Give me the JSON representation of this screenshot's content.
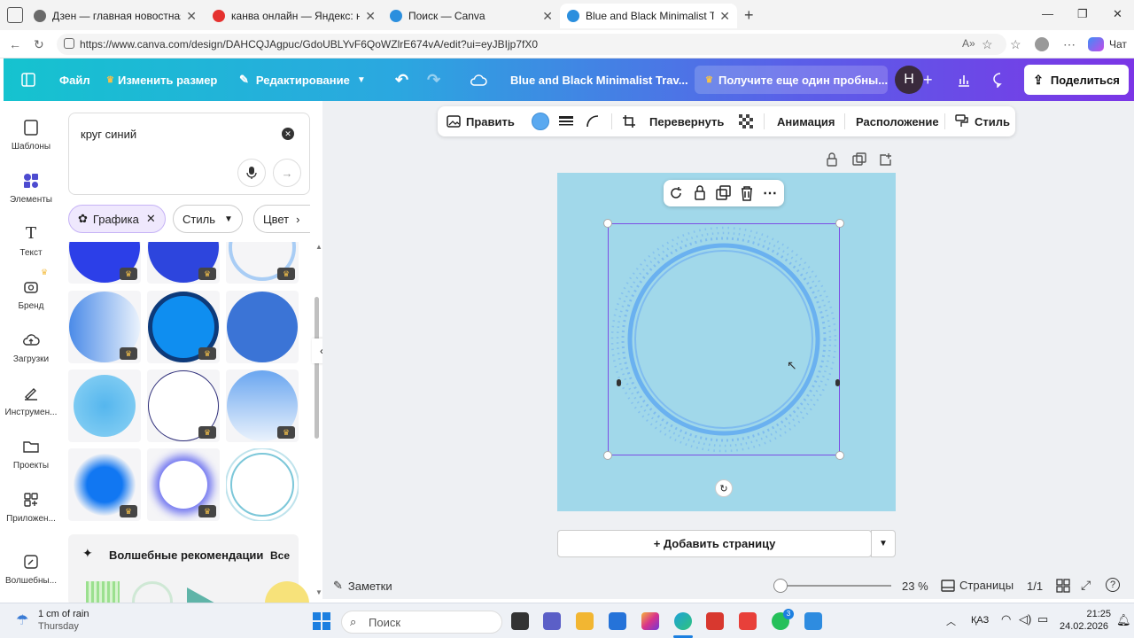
{
  "browser": {
    "tabs": [
      {
        "title": "Дзен — главная новостная инфо",
        "color": "#6a6a6a",
        "active": false
      },
      {
        "title": "канва онлайн — Яндекс: нашлось",
        "color": "#e5312f",
        "active": false
      },
      {
        "title": "Поиск — Canva",
        "color": "#2b8fde",
        "active": false
      },
      {
        "title": "Blue and Black Minimalist Travel A",
        "color": "#2b8fde",
        "active": true
      }
    ],
    "url": "https://www.canva.com/design/DAHCQJAgpuc/GdoUBLYvF6QoWZlrE674vA/edit?ui=eyJBIjp7fX0",
    "chat_label": "Чат"
  },
  "header": {
    "file": "Файл",
    "resize": "Изменить размер",
    "editing": "Редактирование",
    "doc_title": "Blue and Black Minimalist Trav...",
    "trial": "Получите еще один пробны...",
    "avatar_letter": "H",
    "share": "Поделиться"
  },
  "rail": [
    {
      "label": "Шаблоны",
      "icon": "templates-icon"
    },
    {
      "label": "Элементы",
      "icon": "elements-icon"
    },
    {
      "label": "Текст",
      "icon": "text-icon"
    },
    {
      "label": "Бренд",
      "icon": "brand-icon"
    },
    {
      "label": "Загрузки",
      "icon": "uploads-icon"
    },
    {
      "label": "Инструмен...",
      "icon": "tools-icon"
    },
    {
      "label": "Проекты",
      "icon": "projects-icon"
    },
    {
      "label": "Приложен...",
      "icon": "apps-icon"
    },
    {
      "label": "Волшебны...",
      "icon": "magic-icon"
    }
  ],
  "panel": {
    "search_value": "круг синий",
    "chip_graphics": "Графика",
    "chip_style": "Стиль",
    "chip_color": "Цвет",
    "magic_title": "Волшебные рекомендации",
    "magic_all": "Все"
  },
  "toolbar": {
    "edit": "Править",
    "flip": "Перевернуть",
    "animation": "Анимация",
    "position": "Расположение",
    "style": "Стиль",
    "fill_color": "#5aa9f0"
  },
  "canvas": {
    "background": "#a1d8ea",
    "add_page": "+ Добавить страницу"
  },
  "footer": {
    "notes": "Заметки",
    "zoom": "23 %",
    "zoom_level": 0.23,
    "pages": "Страницы",
    "page_count": "1/1"
  },
  "taskbar": {
    "weather_title": "1 cm of rain",
    "weather_sub": "Thursday",
    "search": "Поиск",
    "lang": "ҚАЗ",
    "time": "21:25",
    "date": "24.02.2026"
  }
}
